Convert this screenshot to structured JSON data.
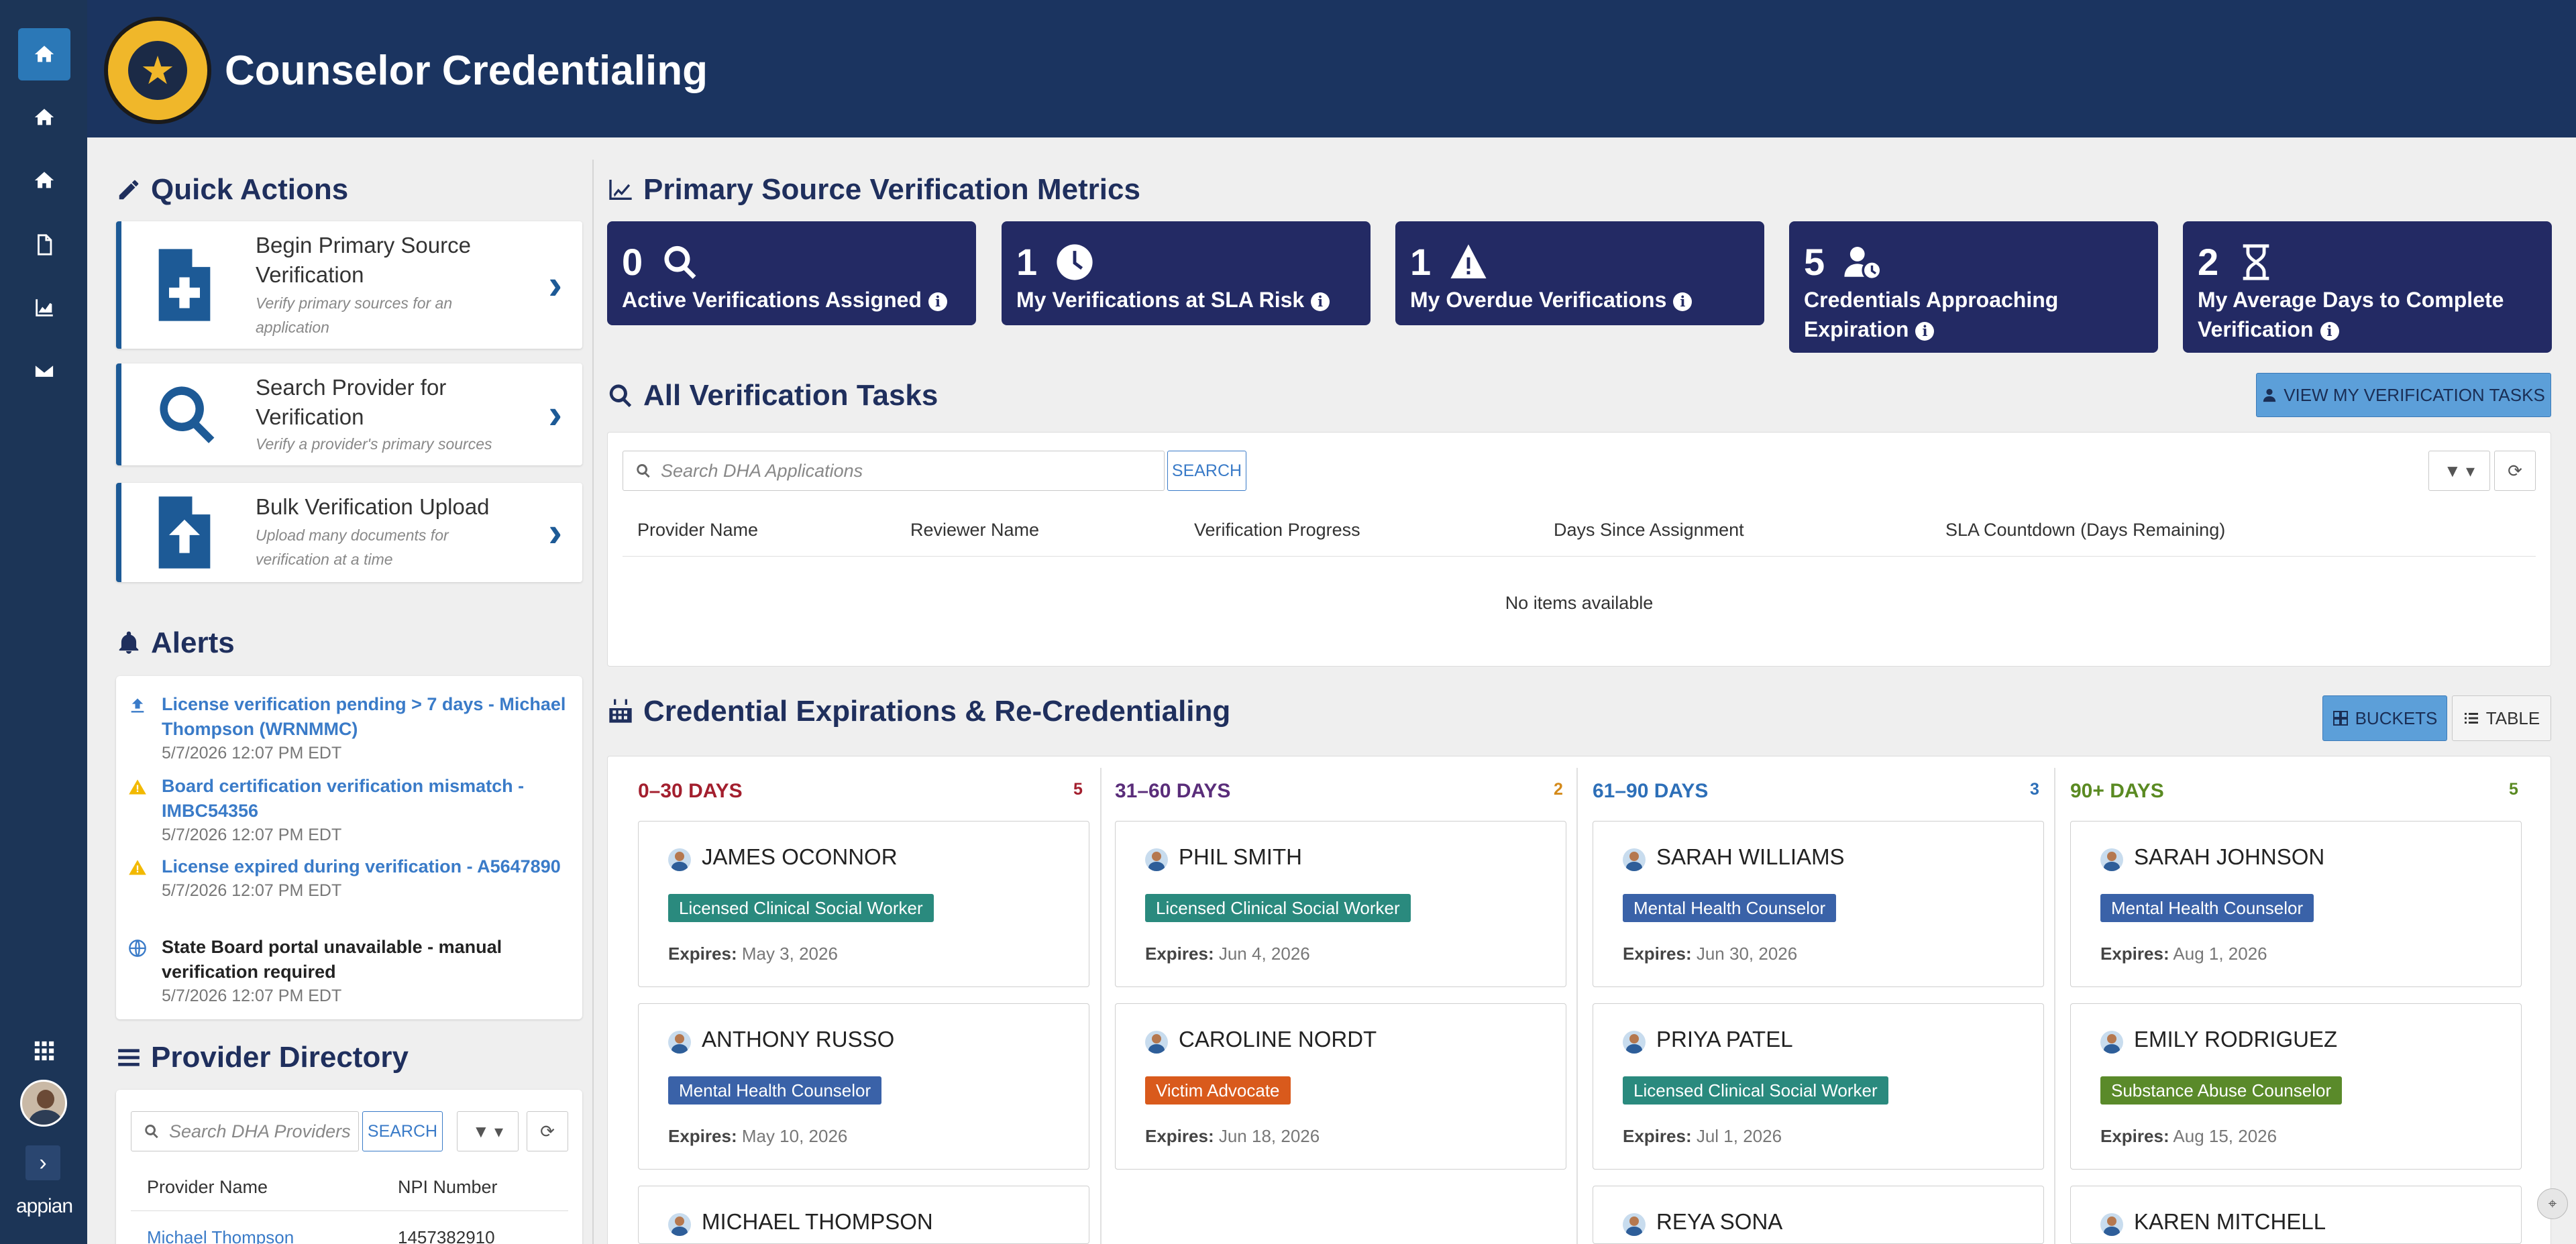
{
  "app": {
    "title": "Counselor Credentialing",
    "brand": "appian"
  },
  "colors": {
    "header": "#1b3460",
    "rail": "#1c3557",
    "metric_tile": "#232a64",
    "accent": "#1d5a96"
  },
  "rail": {
    "icons": [
      "home-icon",
      "home-icon",
      "home-icon",
      "document-icon",
      "chart-icon",
      "mail-icon"
    ]
  },
  "quick_actions": {
    "title": "Quick Actions",
    "items": [
      {
        "title": "Begin Primary Source Verification",
        "subtitle": "Verify primary sources for an application",
        "icon": "file-plus-icon"
      },
      {
        "title": "Search Provider for Verification",
        "subtitle": "Verify a provider's primary sources",
        "icon": "search-icon"
      },
      {
        "title": "Bulk Verification Upload",
        "subtitle": "Upload many documents for verification at a time",
        "icon": "file-upload-icon"
      }
    ]
  },
  "alerts": {
    "title": "Alerts",
    "items": [
      {
        "text": "License verification pending > 7 days - Michael Thompson (WRNMMC)",
        "time": "5/7/2026 12:07 PM EDT",
        "icon": "upload-arrow-icon",
        "link": true
      },
      {
        "text": "Board certification verification mismatch - IMBC54356",
        "time": "5/7/2026 12:07 PM EDT",
        "icon": "warning-icon",
        "link": true
      },
      {
        "text": "License expired during verification - A5647890",
        "time": "5/7/2026 12:07 PM EDT",
        "icon": "warning-icon",
        "link": true
      },
      {
        "text": "State Board portal unavailable - manual verification required",
        "time": "5/7/2026 12:07 PM EDT",
        "icon": "globe-icon",
        "link": false
      }
    ]
  },
  "directory": {
    "title": "Provider Directory",
    "search_placeholder": "Search DHA Providers",
    "search_label": "SEARCH",
    "columns": [
      "Provider Name",
      "NPI Number"
    ],
    "rows": [
      {
        "name": "Michael Thompson",
        "npi": "1457382910"
      }
    ]
  },
  "metrics": {
    "title": "Primary Source Verification Metrics",
    "tiles": [
      {
        "value": "0",
        "label": "Active Verifications Assigned",
        "icon": "search-icon"
      },
      {
        "value": "1",
        "label": "My Verifications at SLA Risk",
        "icon": "clock-icon"
      },
      {
        "value": "1",
        "label": "My Overdue Verifications",
        "icon": "warning-icon"
      },
      {
        "value": "5",
        "label": "Credentials Approaching Expiration",
        "icon": "user-clock-icon"
      },
      {
        "value": "2",
        "label": "My Average Days to Complete Verification",
        "icon": "hourglass-icon"
      }
    ]
  },
  "tasks": {
    "title": "All Verification Tasks",
    "view_button": "VIEW MY VERIFICATION TASKS",
    "search_placeholder": "Search DHA Applications",
    "search_label": "SEARCH",
    "columns": [
      "Provider Name",
      "Reviewer Name",
      "Verification Progress",
      "Days Since Assignment",
      "SLA Countdown (Days Remaining)"
    ],
    "empty_text": "No items available"
  },
  "expirations": {
    "title": "Credential Expirations & Re-Credentialing",
    "buckets_label": "BUCKETS",
    "table_label": "TABLE",
    "buckets": [
      {
        "label": "0–30 DAYS",
        "count": "5",
        "color": "#a31f2e",
        "cards": [
          {
            "name": "JAMES OCONNOR",
            "role": "Licensed Clinical Social Worker",
            "role_color": "#2a8a7e",
            "expires": "May 3, 2026"
          },
          {
            "name": "ANTHONY RUSSO",
            "role": "Mental Health Counselor",
            "role_color": "#3a62a8",
            "expires": "May 10, 2026"
          },
          {
            "name": "MICHAEL THOMPSON",
            "role": "",
            "role_color": "",
            "expires": ""
          }
        ]
      },
      {
        "label": "31–60 DAYS",
        "count": "2",
        "color": "#5a2d7a",
        "count_color": "#d48a1a",
        "cards": [
          {
            "name": "PHIL SMITH",
            "role": "Licensed Clinical Social Worker",
            "role_color": "#2a8a7e",
            "expires": "Jun 4, 2026"
          },
          {
            "name": "CAROLINE NORDT",
            "role": "Victim Advocate",
            "role_color": "#d95a1c",
            "expires": "Jun 18, 2026"
          }
        ]
      },
      {
        "label": "61–90 DAYS",
        "count": "3",
        "color": "#2d6fb8",
        "cards": [
          {
            "name": "SARAH WILLIAMS",
            "role": "Mental Health Counselor",
            "role_color": "#3a62a8",
            "expires": "Jun 30, 2026"
          },
          {
            "name": "PRIYA PATEL",
            "role": "Licensed Clinical Social Worker",
            "role_color": "#2a8a7e",
            "expires": "Jul 1, 2026"
          },
          {
            "name": "REYA SONA",
            "role": "",
            "role_color": "",
            "expires": ""
          }
        ]
      },
      {
        "label": "90+ DAYS",
        "count": "5",
        "color": "#5a8a22",
        "cards": [
          {
            "name": "SARAH JOHNSON",
            "role": "Mental Health Counselor",
            "role_color": "#3a62a8",
            "expires": "Aug 1, 2026"
          },
          {
            "name": "EMILY RODRIGUEZ",
            "role": "Substance Abuse Counselor",
            "role_color": "#5a8a2a",
            "expires": "Aug 15, 2026"
          },
          {
            "name": "KAREN MITCHELL",
            "role": "",
            "role_color": "",
            "expires": ""
          }
        ]
      }
    ],
    "expires_prefix": "Expires:"
  }
}
